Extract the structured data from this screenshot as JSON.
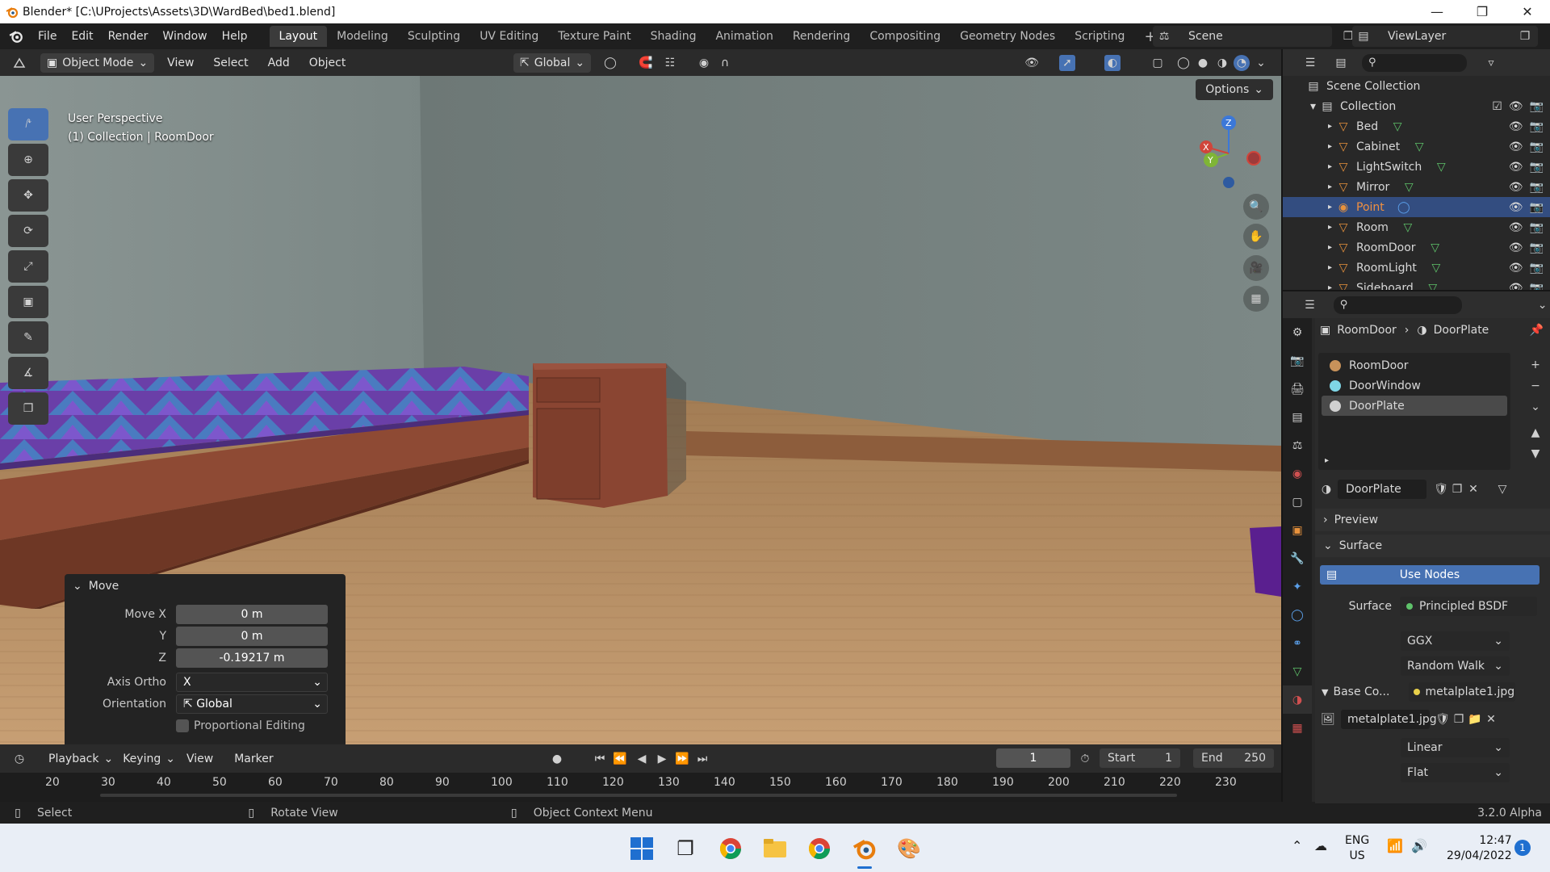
{
  "window": {
    "title": "Blender* [C:\\UProjects\\Assets\\3D\\WardBed\\bed1.blend]",
    "controls": [
      "minimize",
      "maximize",
      "close"
    ]
  },
  "menubar": {
    "menus": [
      "File",
      "Edit",
      "Render",
      "Window",
      "Help"
    ],
    "workspaces": [
      "Layout",
      "Modeling",
      "Sculpting",
      "UV Editing",
      "Texture Paint",
      "Shading",
      "Animation",
      "Rendering",
      "Compositing",
      "Geometry Nodes",
      "Scripting"
    ],
    "active_workspace": "Layout",
    "add_tab": "+",
    "scene": "Scene",
    "view_layer": "ViewLayer"
  },
  "viewport_header": {
    "mode": "Object Mode",
    "menus": [
      "View",
      "Select",
      "Add",
      "Object"
    ],
    "transform_orientation": "Global"
  },
  "viewport": {
    "perspective": "User Perspective",
    "context": "(1) Collection | RoomDoor",
    "options_label": "Options",
    "gizmo_axes": [
      "Z",
      "Y",
      "X"
    ]
  },
  "move_panel": {
    "title": "Move",
    "fields": [
      {
        "label": "Move X",
        "value": "0 m"
      },
      {
        "label": "Y",
        "value": "0 m"
      },
      {
        "label": "Z",
        "value": "-0.19217 m"
      }
    ],
    "axis_ortho_label": "Axis Ortho",
    "axis_ortho_value": "X",
    "orientation_label": "Orientation",
    "orientation_value": "Global",
    "proportional_label": "Proportional Editing"
  },
  "timeline": {
    "menus": [
      "Playback",
      "Keying",
      "View",
      "Marker"
    ],
    "current_frame": "1",
    "start_label": "Start",
    "start_value": "1",
    "end_label": "End",
    "end_value": "250",
    "ruler": [
      "20",
      "30",
      "40",
      "50",
      "60",
      "70",
      "80",
      "90",
      "100",
      "110",
      "120",
      "130",
      "140",
      "150",
      "160",
      "170",
      "180",
      "190",
      "200",
      "210",
      "220",
      "230"
    ]
  },
  "statusbar": {
    "select": "Select",
    "rotate": "Rotate View",
    "context_menu": "Object Context Menu",
    "version": "3.2.0 Alpha"
  },
  "outliner": {
    "scene_collection": "Scene Collection",
    "collection": "Collection",
    "items": [
      {
        "name": "Bed",
        "type": "mesh"
      },
      {
        "name": "Cabinet",
        "type": "mesh"
      },
      {
        "name": "LightSwitch",
        "type": "mesh"
      },
      {
        "name": "Mirror",
        "type": "mesh"
      },
      {
        "name": "Point",
        "type": "light"
      },
      {
        "name": "Room",
        "type": "mesh"
      },
      {
        "name": "RoomDoor",
        "type": "mesh"
      },
      {
        "name": "RoomLight",
        "type": "mesh"
      },
      {
        "name": "Sideboard",
        "type": "mesh"
      }
    ],
    "selected": "Point"
  },
  "properties": {
    "breadcrumb_object": "RoomDoor",
    "breadcrumb_material": "DoorPlate",
    "material_slots": [
      {
        "name": "RoomDoor",
        "color": "#c8925a"
      },
      {
        "name": "DoorWindow",
        "color": "#7fd6e6"
      },
      {
        "name": "DoorPlate",
        "color": "#d0d0d0"
      }
    ],
    "active_slot": "DoorPlate",
    "material_name": "DoorPlate",
    "preview_label": "Preview",
    "surface_section": "Surface",
    "use_nodes": "Use Nodes",
    "surface_label": "Surface",
    "surface_value": "Principled BSDF",
    "distribution": "GGX",
    "subsurface_method": "Random Walk",
    "base_color_label": "Base Co...",
    "base_color_value": "metalplate1.jpg",
    "image_name": "metalplate1.jpg",
    "interpolation": "Linear",
    "projection": "Flat"
  },
  "taskbar": {
    "language": "ENG",
    "region": "US",
    "time": "12:47",
    "date": "29/04/2022",
    "notifications": "1"
  },
  "colors": {
    "accent": "#4772b3",
    "selected_row": "#334d80",
    "selected_text": "#f09040"
  }
}
